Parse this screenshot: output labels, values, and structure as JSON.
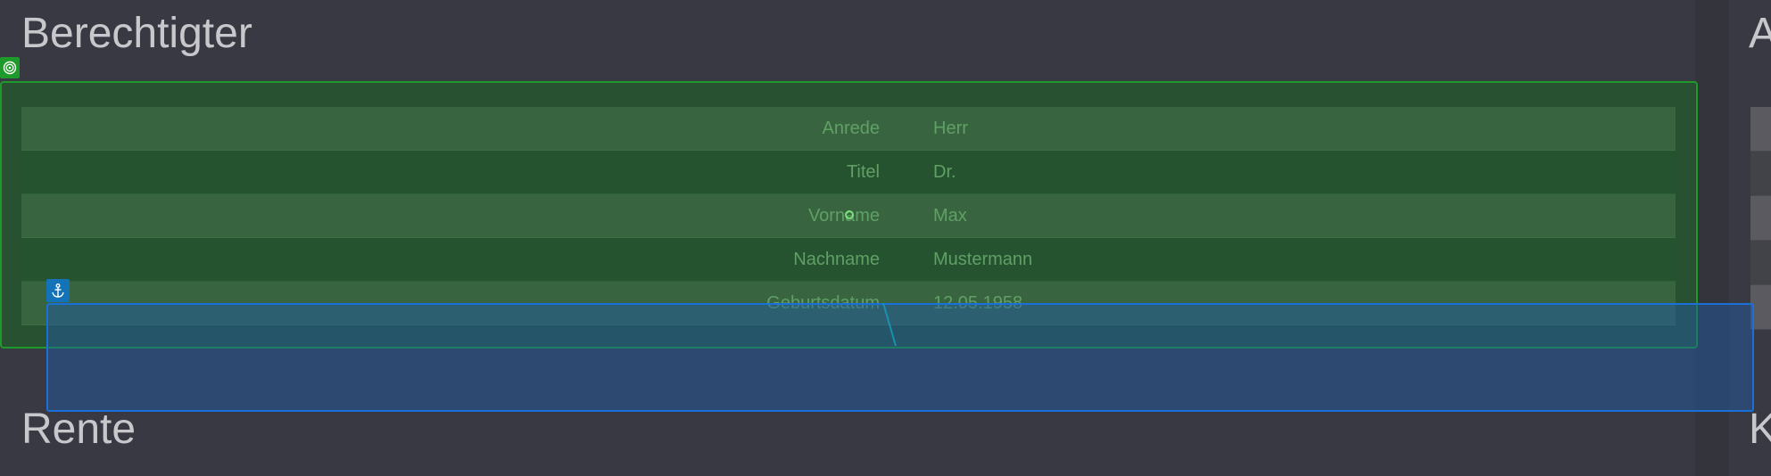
{
  "beneficiary": {
    "title": "Berechtigter",
    "rows": [
      {
        "label": "Anrede",
        "value": "Herr"
      },
      {
        "label": "Titel",
        "value": "Dr."
      },
      {
        "label": "Vorname",
        "value": "Max"
      },
      {
        "label": "Nachname",
        "value": "Mustermann"
      },
      {
        "label": "Geburtsdatum",
        "value": "12.05.1958"
      }
    ]
  },
  "pension": {
    "title": "Rente"
  },
  "right_panel": {
    "top_title_partial": "A",
    "bottom_title_partial": "K"
  },
  "overlays": {
    "green_marker_icon": "target-icon",
    "blue_marker_icon": "anchor-icon",
    "green_color": "#1e9a2a",
    "blue_color": "#1a6fd8"
  }
}
